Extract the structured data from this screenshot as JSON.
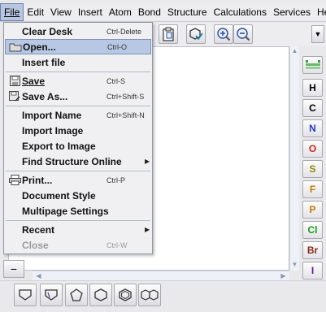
{
  "menubar": {
    "items": [
      {
        "label": "File",
        "active": true
      },
      {
        "label": "Edit"
      },
      {
        "label": "View"
      },
      {
        "label": "Insert"
      },
      {
        "label": "Atom"
      },
      {
        "label": "Bond"
      },
      {
        "label": "Structure"
      },
      {
        "label": "Calculations"
      },
      {
        "label": "Services"
      },
      {
        "label": "Help"
      }
    ]
  },
  "file_menu": {
    "items": [
      {
        "label": "Clear Desk",
        "shortcut": "Ctrl-Delete"
      },
      {
        "label": "Open...",
        "shortcut": "Ctrl-O",
        "icon": "folder-icon",
        "selected": true
      },
      {
        "label": "Insert file"
      },
      {
        "label": "Save",
        "shortcut": "Ctrl-S",
        "icon": "floppy-disk-icon"
      },
      {
        "label": "Save As...",
        "shortcut": "Ctrl+Shift-S",
        "icon": "save-as-icon"
      },
      {
        "label": "Import Name",
        "shortcut": "Ctrl+Shift-N"
      },
      {
        "label": "Import Image"
      },
      {
        "label": "Export to Image"
      },
      {
        "label": "Find Structure Online",
        "submenu": true
      },
      {
        "label": "Print...",
        "shortcut": "Ctrl-P",
        "icon": "printer-icon"
      },
      {
        "label": "Document Style"
      },
      {
        "label": "Multipage Settings"
      },
      {
        "label": "Recent",
        "submenu": true
      },
      {
        "label": "Close",
        "shortcut": "Ctrl-W",
        "disabled": true
      }
    ]
  },
  "palette": {
    "elements": [
      {
        "symbol": "H",
        "color": "#000000"
      },
      {
        "symbol": "C",
        "color": "#000000"
      },
      {
        "symbol": "N",
        "color": "#1f3fc4"
      },
      {
        "symbol": "O",
        "color": "#d4201a"
      },
      {
        "symbol": "S",
        "color": "#8c8a00"
      },
      {
        "symbol": "F",
        "color": "#c47a00"
      },
      {
        "symbol": "P",
        "color": "#c47a00"
      },
      {
        "symbol": "Cl",
        "color": "#1a9a1a"
      },
      {
        "symbol": "Br",
        "color": "#8a2a1a"
      },
      {
        "symbol": "I",
        "color": "#6a1a9a"
      }
    ]
  },
  "icons": {
    "toolbar": [
      "clipboard-paste-icon",
      "clean-structure-icon",
      "zoom-in-icon",
      "zoom-out-icon",
      "dropdown-arrow-icon"
    ],
    "shapes": [
      "cyclopropane-ring-icon",
      "cyclobutane-ring-icon",
      "cyclopentane-ring-icon",
      "cyclohexane-ring-icon",
      "benzene-ring-icon",
      "naphthalene-ring-icon"
    ]
  },
  "zoom": {
    "minus_label": "−"
  }
}
